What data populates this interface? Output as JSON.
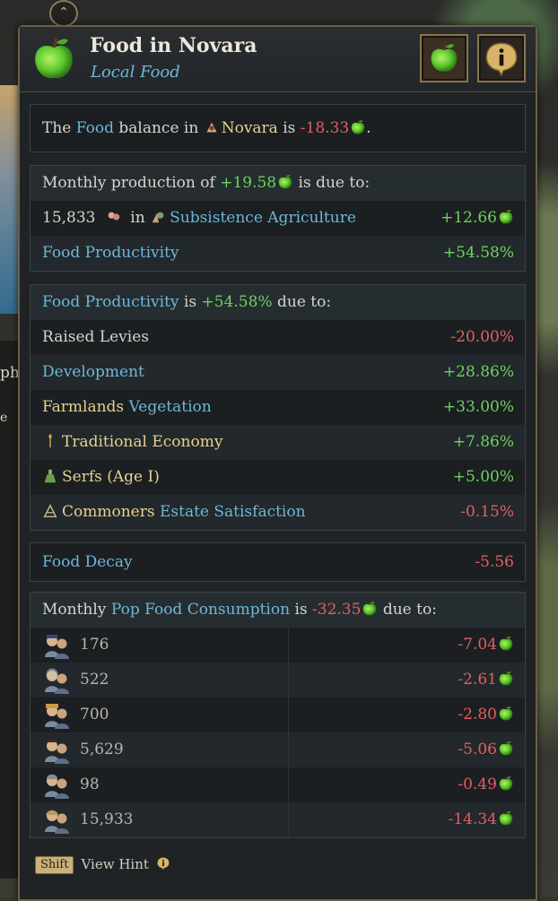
{
  "header": {
    "title": "Food in Novara",
    "subtitle": "Local Food"
  },
  "balance": {
    "pre": "The ",
    "food": "Food",
    "mid": " balance in ",
    "location": "Novara",
    "is": " is ",
    "value": "-18.33",
    "end": "."
  },
  "production": {
    "pre": "Monthly production of ",
    "value": "+19.58",
    "post": " is due to:",
    "pops": "15,833",
    "in": " in ",
    "source": "Subsistence Agriculture",
    "source_value": "+12.66",
    "productivity_label": "Food Productivity",
    "productivity_value": "+54.58%"
  },
  "productivity": {
    "label": "Food Productivity",
    "is": " is ",
    "value": "+54.58%",
    "post": " due to:",
    "items": [
      {
        "label": "Raised Levies",
        "value": "-20.00%"
      },
      {
        "label": "Development",
        "value": "+28.86%"
      },
      {
        "label_a": "Farmlands",
        "label_b": "Vegetation",
        "value": "+33.00%"
      },
      {
        "label": "Traditional Economy",
        "value": "+7.86%"
      },
      {
        "label": "Serfs (Age I)",
        "value": "+5.00%"
      },
      {
        "label_a": "Commoners",
        "label_b": "Estate Satisfaction",
        "value": "-0.15%"
      }
    ]
  },
  "decay": {
    "label": "Food Decay",
    "value": "-5.56"
  },
  "consumption": {
    "pre": "Monthly ",
    "label": "Pop Food Consumption",
    "is": " is ",
    "value": "-32.35",
    "post": " due to:",
    "rows": [
      {
        "count": "176",
        "value": "-7.04"
      },
      {
        "count": "522",
        "value": "-2.61"
      },
      {
        "count": "700",
        "value": "-2.80"
      },
      {
        "count": "5,629",
        "value": "-5.06"
      },
      {
        "count": "98",
        "value": "-0.49"
      },
      {
        "count": "15,933",
        "value": "-14.34"
      }
    ]
  },
  "footer": {
    "key": "Shift",
    "hint": "View Hint"
  },
  "background": {
    "partial_text_1": "ph",
    "partial_text_2": "e"
  },
  "colors": {
    "positive": "#6ed35c",
    "negative": "#e06060",
    "link": "#6db8d8",
    "gold": "#e8d28c"
  }
}
